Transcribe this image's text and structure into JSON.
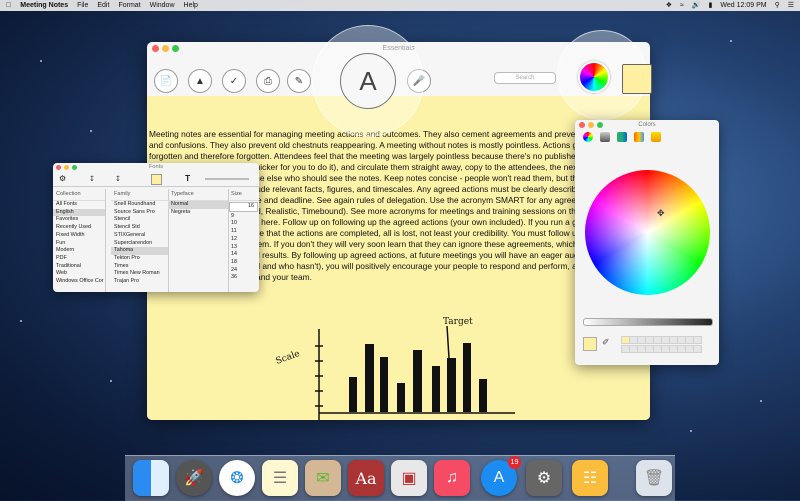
{
  "menubar": {
    "app_name": "Meeting Notes",
    "menus": [
      "File",
      "Edit",
      "Format",
      "Window",
      "Help"
    ],
    "clock": "Wed 12:09 PM"
  },
  "window": {
    "title": "Essentials",
    "search_placeholder": "Search",
    "font_button_label": "A",
    "document_text": "Meeting notes are essential for managing meeting actions and outcomes. They also cement agreements and prevent disputes and confusions. They also prevent old chestnuts reappearing. A meeting without notes is mostly pointless. Actions get forgotten and therefore forgotten. Attendees feel that the meeting was largely pointless because there's no published record. Write the notes (it's usually quicker for you to do it), and circulate them straight away, copy to the attendees, the next meeting if applicable, and copy to anyone else who should see the notes. Keep notes concise - people won't read them, but they must still be precise and clear. Include relevant facts, figures, and timescales. Any agreed actions must be clearly described, with person or persons responsible and deadline. See again rules of delegation. Use the acronym SMART for any agreed action (Specific, Measurable, Agreed, Realistic, Timebound). See more acronyms for meetings and training sessions on the acronyms page. Emphasise it here. Follow up on following up the agreed actions (your own included). If you run a great meeting, but then fail to ensure that the actions are completed, all is lost, not least your credibility. You must follow up the actions and check and see them. If you don't they will very soon learn that they can ignore these agreements, which is the death of managing teams and results. By following up agreed actions, at future meetings you will have an eager audience waiting to see who's delivered and who hasn't), you will positively encourage your people to respond and perform, and you will make meetings work for you and your team.",
    "sketch_labels": {
      "scale": "Scale",
      "target": "Target"
    }
  },
  "fonts_panel": {
    "title": "Fonts",
    "collection_header": "Collection",
    "family_header": "Family",
    "typeface_header": "Typeface",
    "size_header": "Size",
    "size_value": "16",
    "collections": [
      "All Fonts",
      "English",
      "Favorites",
      "Recently Used",
      "Fixed Width",
      "Fun",
      "Modern",
      "PDF",
      "Traditional",
      "Web",
      "Windows Office Cor"
    ],
    "families": [
      "Snell Roundhand",
      "Source Sans Pro",
      "Stencil",
      "Stencil Std",
      "STIXGeneral",
      "Superclarendon",
      "Tahoma",
      "Tekton Pro",
      "Times",
      "Times New Roman",
      "Trajan Pro"
    ],
    "typefaces": [
      "Normal",
      "Negreta"
    ],
    "sizes": [
      "9",
      "10",
      "11",
      "12",
      "13",
      "14",
      "18",
      "24",
      "36"
    ]
  },
  "colors_panel": {
    "title": "Colors",
    "current_color": "#fdf0a0"
  },
  "dock": {
    "apps": [
      "Finder",
      "Launchpad",
      "Safari",
      "Notes",
      "Mail",
      "Dictionary",
      "Preview",
      "Music",
      "App Store",
      "System Preferences",
      "Meeting Notes",
      "Trash"
    ],
    "app_store_badge": "19"
  }
}
